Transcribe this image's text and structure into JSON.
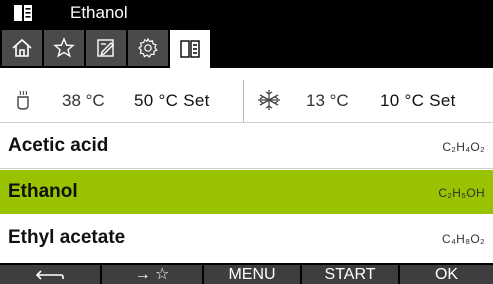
{
  "header": {
    "title": "Ethanol",
    "icon": "book-icon"
  },
  "tabs": [
    {
      "icon": "home-icon",
      "active": false
    },
    {
      "icon": "star-icon",
      "active": false
    },
    {
      "icon": "edit-icon",
      "active": false
    },
    {
      "icon": "settings-icon",
      "active": false
    },
    {
      "icon": "book-icon",
      "active": true
    }
  ],
  "temperatures": {
    "heater": {
      "icon": "heater-icon",
      "actual": "38 °C",
      "set": "50 °C Set"
    },
    "cooler": {
      "icon": "snowflake-icon",
      "actual": "13 °C",
      "set": "10 °C Set"
    }
  },
  "list": {
    "items": [
      {
        "name": "Acetic acid",
        "formula": "C₂H₄O₂",
        "selected": false
      },
      {
        "name": "Ethanol",
        "formula": "C₂H₅OH",
        "selected": true
      },
      {
        "name": "Ethyl acetate",
        "formula": "C₄H₈O₂",
        "selected": false
      }
    ]
  },
  "softkeys": {
    "back": {
      "icon": "back-arrow-icon"
    },
    "favorite": {
      "icon": "arrow-star-icon",
      "label": "→ ☆"
    },
    "menu": "MENU",
    "start": "START",
    "ok": "OK"
  },
  "colors": {
    "selected": "#99c200",
    "bar": "#000000",
    "tab": "#4a4a4a",
    "key": "#3e3e3e"
  }
}
